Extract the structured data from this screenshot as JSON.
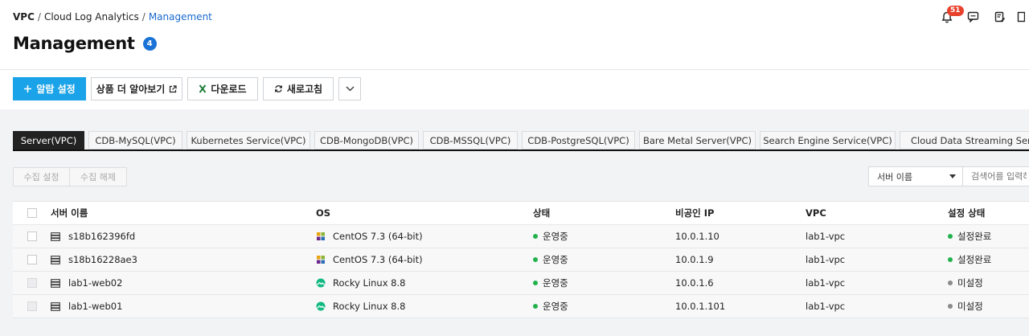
{
  "breadcrumb": {
    "root": "VPC",
    "middle": "Cloud Log Analytics",
    "current": "Management",
    "sep": "/"
  },
  "page": {
    "title": "Management",
    "badge": "4"
  },
  "notifications": {
    "count": "51"
  },
  "toolbar": {
    "add_alarm": "알람 설정",
    "more_products": "상품 더 알아보기",
    "download": "다운로드",
    "refresh": "새로고침"
  },
  "tabs": [
    {
      "label": "Server(VPC)",
      "active": true
    },
    {
      "label": "CDB-MySQL(VPC)"
    },
    {
      "label": "Kubernetes Service(VPC)"
    },
    {
      "label": "CDB-MongoDB(VPC)"
    },
    {
      "label": "CDB-MSSQL(VPC)"
    },
    {
      "label": "CDB-PostgreSQL(VPC)"
    },
    {
      "label": "Bare Metal Server(VPC)"
    },
    {
      "label": "Search Engine Service(VPC)"
    },
    {
      "label": "Cloud Data Streaming Servi"
    }
  ],
  "actions": {
    "collect_on": "수집 설정",
    "collect_off": "수집 해제"
  },
  "filter": {
    "selected": "서버 이름",
    "placeholder": "검색어를 입력하"
  },
  "table": {
    "headers": {
      "name": "서버 이름",
      "os": "OS",
      "state": "상태",
      "ip": "비공인 IP",
      "vpc": "VPC",
      "setting": "설정 상태"
    },
    "rows": [
      {
        "name": "s18b162396fd",
        "os": "CentOS 7.3 (64-bit)",
        "state": "운영중",
        "ip": "10.0.1.10",
        "vpc": "lab1-vpc",
        "setting": "설정완료"
      },
      {
        "name": "s18b16228ae3",
        "os": "CentOS 7.3 (64-bit)",
        "state": "운영중",
        "ip": "10.0.1.9",
        "vpc": "lab1-vpc",
        "setting": "설정완료"
      },
      {
        "name": "lab1-web02",
        "os": "Rocky Linux 8.8",
        "state": "운영중",
        "ip": "10.0.1.6",
        "vpc": "lab1-vpc",
        "setting": "미설정"
      },
      {
        "name": "lab1-web01",
        "os": "Rocky Linux 8.8",
        "state": "운영중",
        "ip": "10.0.1.101",
        "vpc": "lab1-vpc",
        "setting": "미설정"
      }
    ]
  },
  "colors": {
    "accent": "#1aa3e8",
    "running": "#22b24c",
    "unset": "#8a8a8a",
    "badge": "#1a73d6",
    "notif": "#e8412c"
  }
}
